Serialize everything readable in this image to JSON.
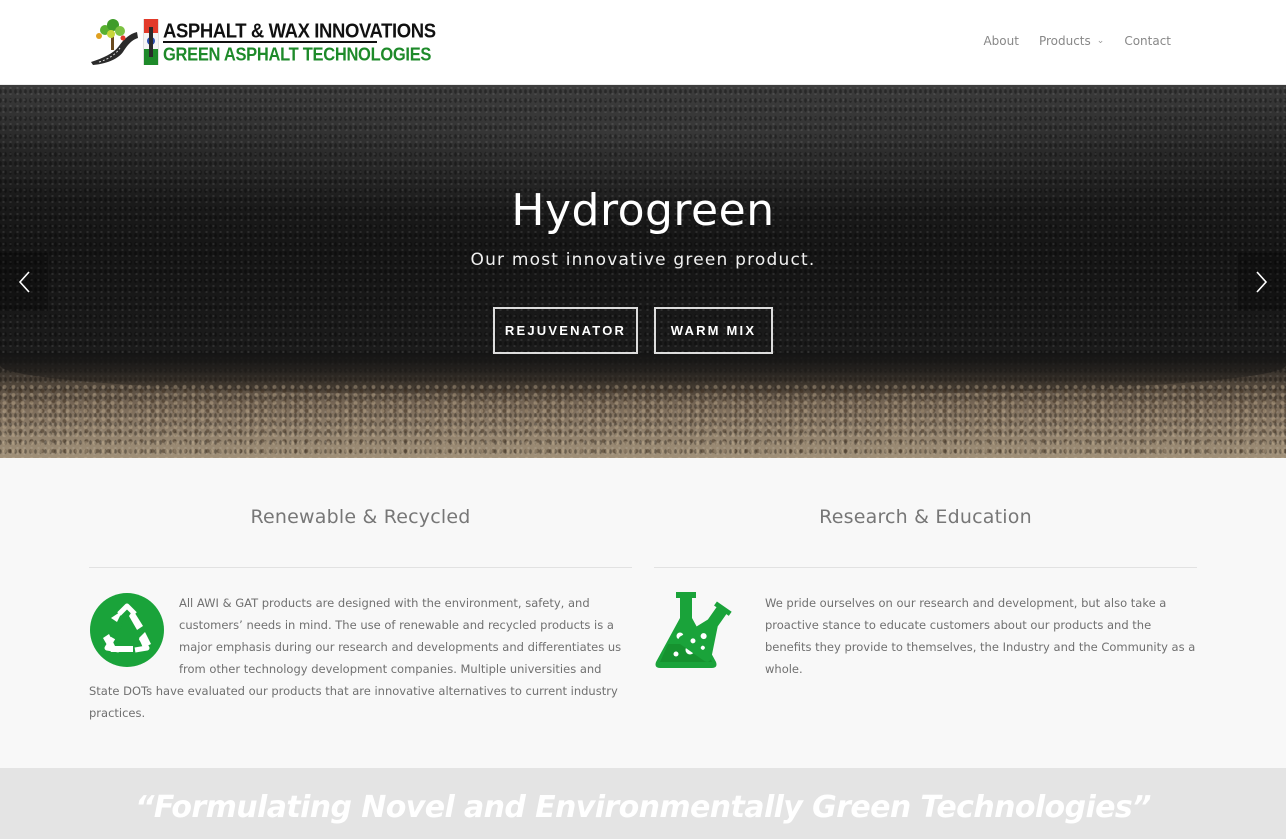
{
  "logo": {
    "line1": "ASPHALT & WAX INNOVATIONS",
    "line2": "GREEN ASPHALT TECHNOLOGIES"
  },
  "nav": {
    "items": [
      {
        "label": "About"
      },
      {
        "label": "Products"
      },
      {
        "label": "Contact"
      }
    ]
  },
  "hero": {
    "title": "Hydrogreen",
    "subtitle": "Our most innovative green product.",
    "buttons": [
      {
        "label": "REJUVENATOR"
      },
      {
        "label": "WARM MIX"
      }
    ]
  },
  "features": [
    {
      "title": "Renewable & Recycled",
      "icon": "recycle-icon",
      "text": "All AWI & GAT products are designed with the environment, safety, and customers’ needs in mind. The use of renewable and recycled products is a major emphasis during our research and developments and differentiates us from other technology development companies. Multiple universities and State DOTs have evaluated our products that are innovative alternatives to current industry practices."
    },
    {
      "title": "Research & Education",
      "icon": "lab-flask-icon",
      "text": "We pride ourselves on our research and development, but also take a proactive stance to educate customers about our products and the benefits they provide to themselves, the Industry and the Community as a whole."
    }
  ],
  "quote": {
    "text": "“Formulating Novel and Environmentally Green Technologies”"
  },
  "colors": {
    "brand_green": "#1e8a2a",
    "icon_green": "#1aa33a",
    "quote_band": "#e4e4e4"
  }
}
